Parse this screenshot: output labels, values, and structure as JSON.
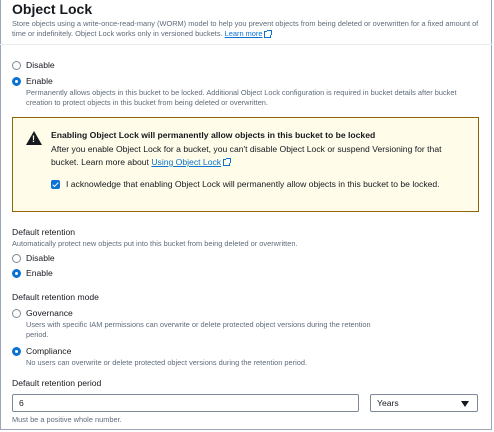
{
  "section": {
    "title": "Object Lock",
    "description": "Store objects using a write-once-read-many (WORM) model to help you prevent objects from being deleted or overwritten for a fixed amount of time or indefinitely. Object Lock works only in versioned buckets.",
    "learn_more": "Learn more"
  },
  "object_lock": {
    "disable_label": "Disable",
    "enable_label": "Enable",
    "enable_description": "Permanently allows objects in this bucket to be locked. Additional Object Lock configuration is required in bucket details after bucket creation to protect objects in this bucket from being deleted or overwritten."
  },
  "warning": {
    "title": "Enabling Object Lock will permanently allow objects in this bucket to be locked",
    "text": "After you enable Object Lock for a bucket, you can't disable Object Lock or suspend Versioning for that bucket. Learn more about",
    "link": "Using Object Lock",
    "acknowledge": "I acknowledge that enabling Object Lock will permanently allow objects in this bucket to be locked."
  },
  "default_retention": {
    "heading": "Default retention",
    "description": "Automatically protect new objects put into this bucket from being deleted or overwritten.",
    "disable_label": "Disable",
    "enable_label": "Enable"
  },
  "retention_mode": {
    "heading": "Default retention mode",
    "governance_label": "Governance",
    "governance_description": "Users with specific IAM permissions can overwrite or delete protected object versions during the retention period.",
    "compliance_label": "Compliance",
    "compliance_description": "No users can overwrite or delete protected object versions during the retention period."
  },
  "retention_period": {
    "heading": "Default retention period",
    "value": "6",
    "unit": "Years",
    "hint": "Must be a positive whole number."
  }
}
